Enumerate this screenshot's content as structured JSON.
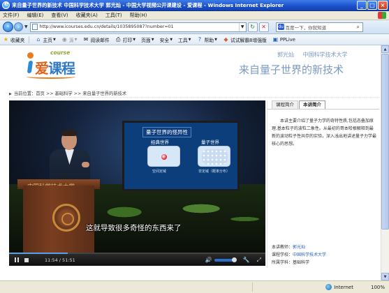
{
  "window": {
    "title": "来自量子世界的新技术  中国科学技术大学  郭光灿 - 中国大学视频公开课建设 - 爱课程 - Windows Internet Explorer",
    "controls": [
      "_",
      "□",
      "×"
    ]
  },
  "menu": [
    "文件(F)",
    "编辑(E)",
    "查看(V)",
    "收藏夹(A)",
    "工具(T)",
    "帮助(H)"
  ],
  "addressbar": {
    "url": "http://www.icourses.edu.cn/details/1035895087?number=01",
    "search_placeholder": "百度一下，你就知道"
  },
  "toolbar": {
    "favorites": "收藏夹",
    "home": "主页",
    "feeds": "源",
    "read_mail": "阅读邮件",
    "print": "打印",
    "page": "页面",
    "safety": "安全",
    "tools": "工具",
    "help": "帮助",
    "crack": "试试解霸8增强版",
    "pplive": "PPLive"
  },
  "header": {
    "logo_course": "course",
    "logo_ai": "爱",
    "logo_rest": "课程",
    "teacher": "郭光灿",
    "school": "中国科学技术大学",
    "title": "来自量子世界的新技术"
  },
  "breadcrumb": "当前位置：首页 >> 基础科学 >> 来自量子世界的新技术",
  "video": {
    "slide_title": "量子世界的怪异性",
    "classical_label": "经典世界",
    "quantum_label": "量子世界",
    "classical_sub": "空间定域",
    "quantum_sub": "非定域（概率分布）",
    "podium_text": "中国科学技术大学",
    "subtitle": "这就导致很多奇怪的东西来了",
    "time": "11:54 / 51:51",
    "progress": 0.23
  },
  "panel": {
    "tabs": [
      "课程简介",
      "本讲简介"
    ],
    "active_tab": 1,
    "intro": "本讲主要介绍了量子力学的奇特性质,包括态叠加原理,基本粒子的波粒二象性。从最初的哥本哈根解释到最新的波动粒子性共存的实验，深入浅出地讲述量子力学最核心的思想。",
    "teacher_label": "本讲教师：",
    "teacher": "郭光灿",
    "school_label": "课程学校：",
    "school": "中国科学技术大学",
    "category_label": "所属学科：",
    "category": "基础科学"
  },
  "statusbar": {
    "zone": "Internet",
    "zoom": "100%"
  },
  "colors": {
    "accent": "#2f79c6",
    "brand_orange": "#e0631c",
    "header_text": "#7a9ac2"
  }
}
